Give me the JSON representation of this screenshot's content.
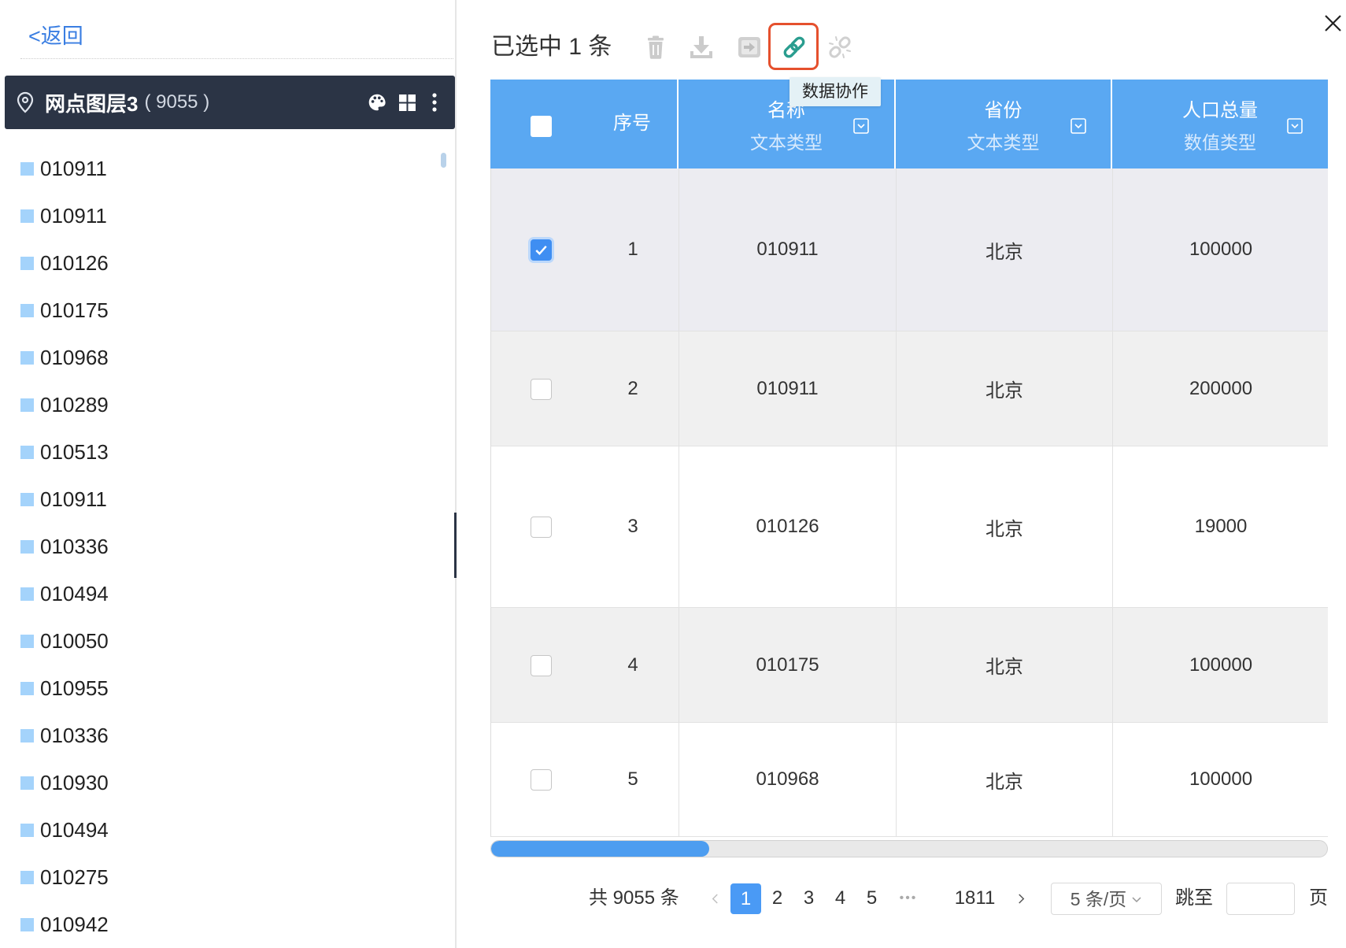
{
  "back_link": "<返回",
  "layer_header": {
    "title": "网点图层3",
    "count": "( 9055 )",
    "icons": [
      "location-pin-icon",
      "palette-icon",
      "grid-icon",
      "more-vertical-icon"
    ]
  },
  "layer_items": [
    {
      "label": "010911"
    },
    {
      "label": "010911"
    },
    {
      "label": "010126"
    },
    {
      "label": "010175"
    },
    {
      "label": "010968"
    },
    {
      "label": "010289"
    },
    {
      "label": "010513"
    },
    {
      "label": "010911"
    },
    {
      "label": "010336"
    },
    {
      "label": "010494"
    },
    {
      "label": "010050"
    },
    {
      "label": "010955"
    },
    {
      "label": "010336"
    },
    {
      "label": "010930"
    },
    {
      "label": "010494"
    },
    {
      "label": "010275"
    },
    {
      "label": "010942"
    }
  ],
  "selection_label": "已选中 1 条",
  "toolbar": {
    "icons": [
      "trash-icon",
      "download-icon",
      "export-icon",
      "link-icon",
      "unlink-icon"
    ],
    "enabled": [
      "link-icon"
    ],
    "highlighted": "link-icon",
    "tooltip": "数据协作"
  },
  "table": {
    "index_header": "序号",
    "columns": [
      {
        "label": "名称",
        "type": "文本类型"
      },
      {
        "label": "省份",
        "type": "文本类型"
      },
      {
        "label": "人口总量",
        "type": "数值类型"
      }
    ],
    "rows": [
      {
        "index": "1",
        "name": "010911",
        "province": "北京",
        "population": "100000",
        "checked": true
      },
      {
        "index": "2",
        "name": "010911",
        "province": "北京",
        "population": "200000",
        "checked": false
      },
      {
        "index": "3",
        "name": "010126",
        "province": "北京",
        "population": "19000",
        "checked": false
      },
      {
        "index": "4",
        "name": "010175",
        "province": "北京",
        "population": "100000",
        "checked": false
      },
      {
        "index": "5",
        "name": "010968",
        "province": "北京",
        "population": "100000",
        "checked": false
      }
    ]
  },
  "pagination": {
    "total": "共 9055 条",
    "pages": [
      {
        "label": "1",
        "active": true
      },
      {
        "label": "2",
        "active": false
      },
      {
        "label": "3",
        "active": false
      },
      {
        "label": "4",
        "active": false
      },
      {
        "label": "5",
        "active": false
      }
    ],
    "ellipsis": "•••",
    "last_page": "1811",
    "page_size": "5 条/页",
    "jump_label": "跳至",
    "page_suffix": "页",
    "icons": [
      "chevron-left-icon",
      "chevron-right-icon",
      "chevron-down-icon"
    ]
  },
  "colors": {
    "header_bg": "#5aa8f2",
    "accent": "#4a9af5",
    "dark_bar": "#2b3445",
    "highlight_border": "#e5502d",
    "link_icon": "#2a9d8f",
    "selected_row": "#ececf1",
    "tooltip_bg": "#e4f1f6"
  }
}
